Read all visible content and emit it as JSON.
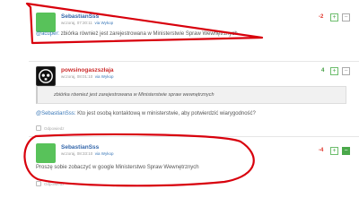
{
  "comments": [
    {
      "username": "SebastianSss",
      "time": "wczoraj, 07:30:11",
      "via": "via Wykop",
      "score": "-2",
      "mention": "@acuper:",
      "text": " zbiórka również jest zarejestrowana w Ministerstwie Spraw Wewnętrznych"
    },
    {
      "username": "powsinogaszszłaja",
      "time": "wczoraj, 08:01:10",
      "via": "via Wykop",
      "score": "4",
      "quote": "zbiórka również jest zarejestrowana w Ministerstwie spraw wewnętrznych",
      "mention": "@SebastianSss:",
      "text": " Kto jest osobą kontaktową w ministerstwie, aby potwierdzić wiarygodność?",
      "reply_label": "Odpowiedz"
    },
    {
      "username": "SebastianSss",
      "time": "wczoraj, 08:33:10",
      "via": "via Wykop",
      "score": "-4",
      "text": "Proszę sobie zobaczyć w google Ministerstwo Spraw Wewnętrznych",
      "reply_label": "Odpowiedz"
    }
  ],
  "vote_plus": "+",
  "vote_minus": "−",
  "colors": {
    "annotation": "#d8000c",
    "accent_green": "#58c25a",
    "link": "#3a78b8"
  },
  "icons": [
    "user-avatar-green",
    "skull-logo-avatar",
    "reply-icon"
  ]
}
